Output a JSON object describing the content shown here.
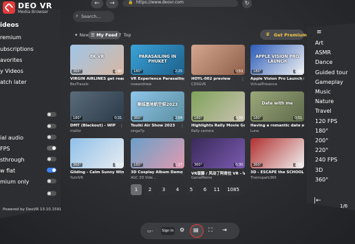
{
  "app": {
    "name": "DEO VR",
    "subtitle": "Media Browser",
    "powered": "Powered by DeoVR 13.10.1591"
  },
  "url": "https://www.deovr.com",
  "left_menu": [
    {
      "label": "ideos"
    },
    {
      "label": "remium"
    },
    {
      "label": "ubscriptions"
    },
    {
      "label": "avorites"
    },
    {
      "label": "y Videos"
    },
    {
      "label": "atch later"
    }
  ],
  "left_settings": [
    {
      "label": ""
    },
    {
      "label": ""
    },
    {
      "label": ""
    },
    {
      "label": "ial audio"
    },
    {
      "label": "FPS"
    },
    {
      "label": "sthrough"
    },
    {
      "label": "w flat"
    },
    {
      "label": "mium only"
    }
  ],
  "search": {
    "placeholder": "Search..."
  },
  "tabs": [
    {
      "label": "New"
    },
    {
      "label": "My Feed"
    },
    {
      "label": "Top"
    }
  ],
  "premium_label": "Get Premium",
  "cards": [
    {
      "title": "VIRGIN AIRLINES get ready for...",
      "author": "BezTravels",
      "duration": "2:30",
      "overlay": "8K VR",
      "colors": [
        "#a0c6e8",
        "#d7b6a0"
      ]
    },
    {
      "title": "VR Experience Parasailing ov...",
      "author": "nowandnew",
      "duration": "2:25",
      "overlay": "PARASAILING IN PHUKET",
      "colors": [
        "#3aa3d8",
        "#1d5f8a"
      ]
    },
    {
      "title": "HOYL-002 preview",
      "author": "CDSGVR",
      "duration": "0:53",
      "overlay": "",
      "colors": [
        "#d4a78f",
        "#8f5f4a"
      ]
    },
    {
      "title": "Apple Vision Pro Launch (VR...",
      "author": "VirtualPresence",
      "duration": "1:31",
      "overlay": "APPLE VISION PRO LAUNCH",
      "colors": [
        "#2b5bb8",
        "#f2f2f2"
      ]
    },
    {
      "title": "DMT (Blackout) - WIP",
      "author": "mallor",
      "duration": "0:31",
      "overlay": "",
      "colors": [
        "#5a6b7a",
        "#2a3a48"
      ]
    },
    {
      "title": "Tsuiki Air Show 2023",
      "author": "singa7p",
      "duration": "2:04",
      "overlay": "築城基地航空祭2023",
      "colors": [
        "#8ec5ea",
        "#5b8fa0"
      ]
    },
    {
      "title": "Highlights Rally Movie Gorice ...",
      "author": "Rally camera",
      "duration": "4:39",
      "overlay": "",
      "colors": [
        "#7fa35a",
        "#c9c2b0"
      ]
    },
    {
      "title": "Having a romantic date with ...",
      "author": "Luna",
      "duration": "0:51",
      "overlay": "Date with me",
      "colors": [
        "#9aa87a",
        "#5e6a4a"
      ]
    },
    {
      "title": "Gliding - Calm Sunny Winter ...",
      "author": "YumiVR",
      "duration": "18:47",
      "overlay": "",
      "colors": [
        "#8fc0e8",
        "#e8ecf0"
      ]
    },
    {
      "title": "3D Cosplay Album Demo No.3",
      "author": "AGC 3D Vide...",
      "duration": "1:27",
      "overlay": "",
      "colors": [
        "#6aa0c8",
        "#e09ab0"
      ]
    },
    {
      "title": "VR版藤 / 风动了阿奇拉 VR - VR ...",
      "author": "GameMeme",
      "duration": "6:30",
      "overlay": "",
      "colors": [
        "#3a2a5a",
        "#7a5ab0"
      ]
    },
    {
      "title": "3D - ESCAPE the SCHOOL - Tie ...",
      "author": "Themspark360",
      "duration": "2:56",
      "overlay": "",
      "colors": [
        "#b13030",
        "#f0f0f0"
      ]
    }
  ],
  "card_badges": [
    "360°",
    "180°",
    "",
    "180°",
    "180°",
    "360°",
    "180°",
    "180°",
    "360°",
    "180°",
    "360°",
    "360°"
  ],
  "categories": [
    "Art",
    "ASMR",
    "Dance",
    "Guided tour",
    "Gameplay",
    "Music",
    "Nature",
    "Travel",
    "120 FPS",
    "180°",
    "200°",
    "220°",
    "240 FPS",
    "3D",
    "360°"
  ],
  "pagination": {
    "pages": [
      "1",
      "2",
      "3",
      "4",
      "5",
      "6",
      "11",
      "1085"
    ],
    "current": "1"
  },
  "right_page_indicator": "1/6",
  "bottom_bar": {
    "sign_in": "Sign In"
  }
}
